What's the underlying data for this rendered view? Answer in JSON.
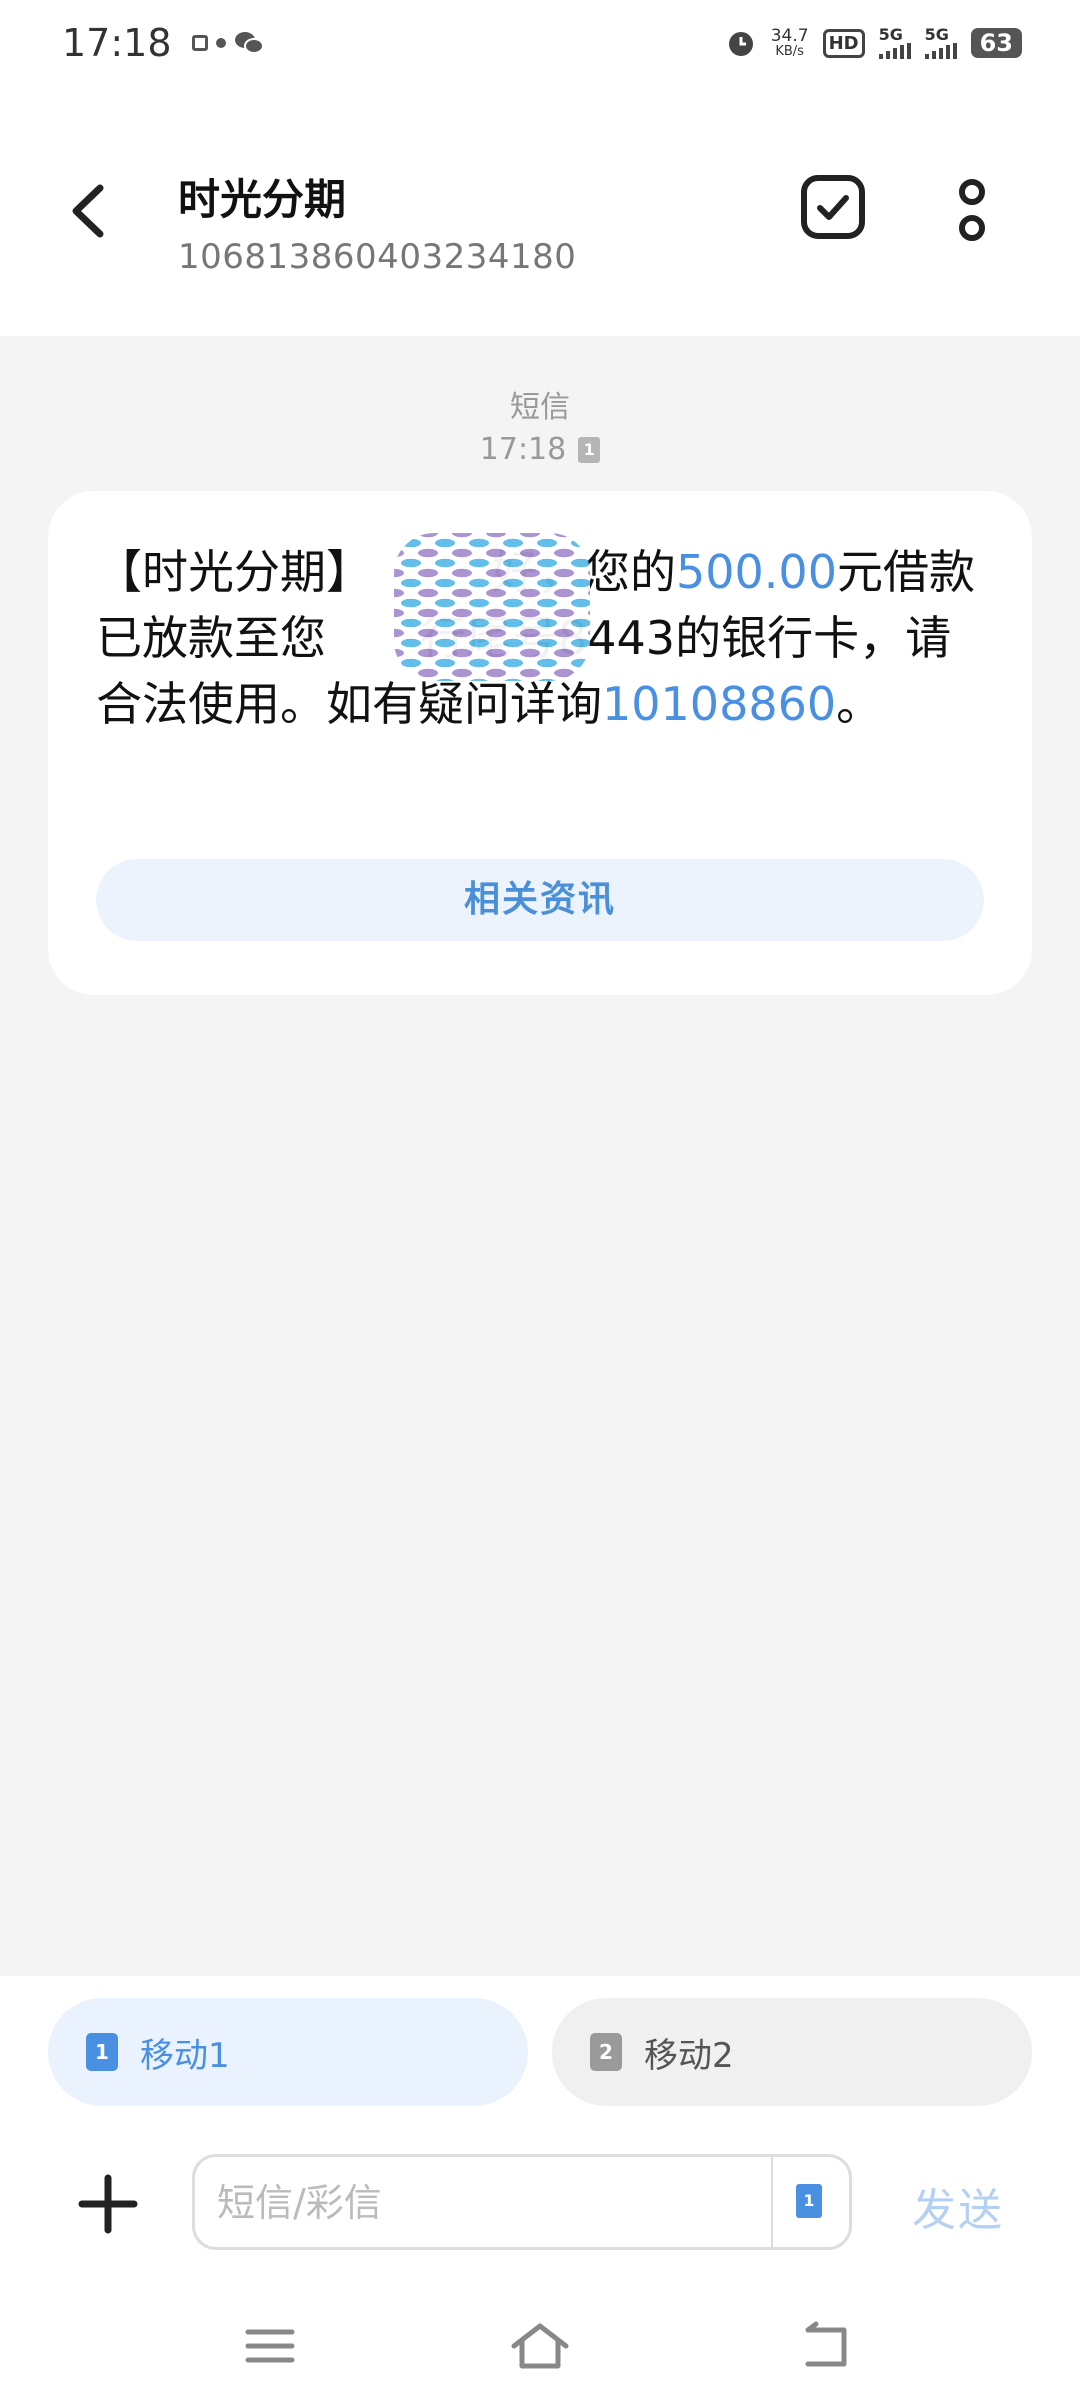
{
  "status_bar": {
    "time": "17:18",
    "speed_value": "34.7",
    "speed_unit": "KB/s",
    "hd": "HD",
    "network1": "5G",
    "network2": "5G",
    "battery": "63"
  },
  "header": {
    "title": "时光分期",
    "number": "106813860403234180"
  },
  "message": {
    "type": "短信",
    "time": "17:18",
    "sim_badge": "1",
    "text_part1": "【时光分期】",
    "text_part2": "好，您的",
    "amount": "500.00",
    "text_part3": "元借款已放款至您",
    "text_part4": "行尾号8443的银行卡，请合法使用。如有疑问详询",
    "phone": "10108860",
    "text_end": "。",
    "action_label": "相关资讯"
  },
  "sim_selector": {
    "sim1_label": "移动1",
    "sim1_badge": "1",
    "sim2_label": "移动2",
    "sim2_badge": "2"
  },
  "composer": {
    "placeholder": "短信/彩信",
    "value": "",
    "sim_badge": "1",
    "send_label": "发送"
  },
  "colors": {
    "accent": "#4a90e2",
    "send_disabled": "#b4d0f2",
    "conversation_bg": "#f4f4f4",
    "action_bg": "#edf3fd"
  }
}
